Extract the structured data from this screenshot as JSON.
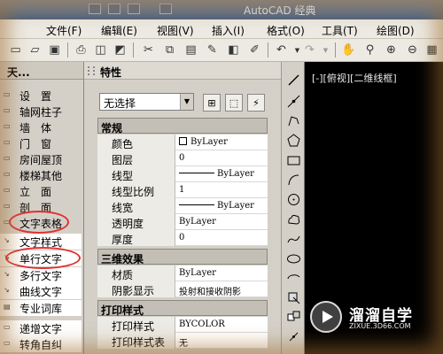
{
  "window": {
    "title": "AutoCAD 经典"
  },
  "menubar": {
    "items": [
      "文件(F)",
      "编辑(E)",
      "视图(V)",
      "插入(I)",
      "格式(O)",
      "工具(T)",
      "绘图(D)"
    ]
  },
  "tool_palette": {
    "header": "天...",
    "items": [
      {
        "label": "设　置",
        "icon": "table-icon"
      },
      {
        "label": "轴网柱子",
        "icon": "grid-icon"
      },
      {
        "label": "墙　体",
        "icon": "wall-icon"
      },
      {
        "label": "门　窗",
        "icon": "door-icon"
      },
      {
        "label": "房间屋顶",
        "icon": "roof-icon"
      },
      {
        "label": "楼梯其他",
        "icon": "stair-icon"
      },
      {
        "label": "立　面",
        "icon": "elevation-icon"
      },
      {
        "label": "剖　面",
        "icon": "section-icon"
      },
      {
        "label": "文字表格",
        "icon": "text-table-icon"
      },
      {
        "label": "文字样式",
        "icon": "text-style-icon"
      },
      {
        "label": "单行文字",
        "icon": "single-line-text-icon"
      },
      {
        "label": "多行文字",
        "icon": "multi-line-text-icon"
      },
      {
        "label": "曲线文字",
        "icon": "curve-text-icon"
      },
      {
        "label": "专业词库",
        "icon": "dictionary-icon"
      },
      {
        "label": "递增文字",
        "icon": "increment-text-icon"
      },
      {
        "label": "转角自纠",
        "icon": "corner-fix-icon"
      }
    ]
  },
  "properties": {
    "title": "特性",
    "selection": "无选择",
    "sections": {
      "general": "常规",
      "three_d": "三维效果",
      "plot": "打印样式"
    },
    "rows": {
      "color": {
        "key": "颜色",
        "value": "ByLayer"
      },
      "layer": {
        "key": "图层",
        "value": "0"
      },
      "linetype": {
        "key": "线型",
        "value": "ByLayer"
      },
      "ltscale": {
        "key": "线型比例",
        "value": "1"
      },
      "lineweight": {
        "key": "线宽",
        "value": "ByLayer"
      },
      "transparency": {
        "key": "透明度",
        "value": "ByLayer"
      },
      "thickness": {
        "key": "厚度",
        "value": "0"
      },
      "material": {
        "key": "材质",
        "value": "ByLayer"
      },
      "shadow": {
        "key": "阴影显示",
        "value": "投射和接收阴影"
      },
      "plotstyle": {
        "key": "打印样式",
        "value": "BYCOLOR"
      },
      "plotstyletable": {
        "key": "打印样式表",
        "value": "无"
      }
    }
  },
  "canvas": {
    "viewport_label": "[-][俯视][二维线框]"
  },
  "watermark": {
    "title": "溜溜自学",
    "url": "ZIXUE.3D66.COM"
  }
}
